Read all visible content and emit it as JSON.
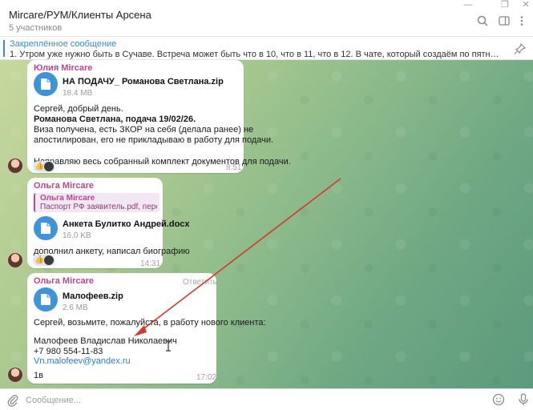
{
  "header": {
    "title": "Mircare/РУМ/Клиенты Арсена",
    "subtitle": "5 участников"
  },
  "pinned": {
    "label": "Закреплённое сообщение",
    "text": "1. Утром уже нужно быть в Сучаве. Встреча может быть что в 10, что в 11, что в 12. В чате, который создаём по пятницам, там будет информирование уже ..."
  },
  "messages": [
    {
      "sender": "Юлия Mircare",
      "file": {
        "name": "НА ПОДАЧУ_ Романова Светлана.zip",
        "size": "18.4 MB"
      },
      "lines": [
        "Сергей, добрый день.",
        "Романова Светлана, подача 19/02/26.",
        "Виза получена,  есть ЗКОР на себя (делала ранее) не",
        "апостилирован, его не  прикладываю в работу для подачи.",
        "",
        "Направляю весь собранный комплект документов для подачи."
      ],
      "time": "8:51"
    },
    {
      "sender": "Ольга Mircare",
      "quote": {
        "name": "Ольга Mircare",
        "text": "Паспорт РФ заявитель.pdf, пересл..."
      },
      "file": {
        "name": "Анкета Булитко Андрей.docx",
        "size": "16.0 KB"
      },
      "lines": [
        "дополнил анкету, написал биографию"
      ],
      "time": "14:31"
    },
    {
      "sender": "Ольга Mircare",
      "reply_label": "Ответить",
      "file": {
        "name": "Малофеев.zip",
        "size": "2.6 MB"
      },
      "lines": [
        "Сергей, возьмите, пожалуйста, в работу нового клиента:",
        "",
        "Малофеев Владислав Николаевич",
        "+7 980 554-11-83"
      ],
      "email": "Vn.malofeev@yandex.ru",
      "footer": "1в",
      "time": "17:02"
    }
  ],
  "composer": {
    "placeholder": "Сообщение..."
  },
  "icons": [
    "search-icon",
    "more-icon",
    "pin-icon",
    "paperclip-icon",
    "emoji-icon",
    "microphone-icon",
    "file-icon"
  ],
  "colors": {
    "accent": "#3a8cd1",
    "sender": "#c0458d",
    "arrow": "#d43a2f"
  }
}
